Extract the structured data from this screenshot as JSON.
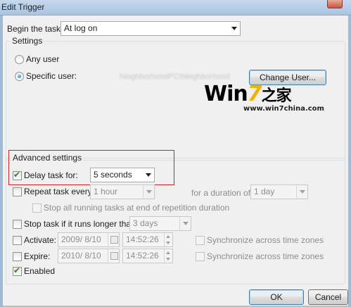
{
  "window": {
    "title": "Edit Trigger"
  },
  "begin": {
    "label": "Begin the task:",
    "value": "At log on"
  },
  "settings": {
    "group_title": "Settings",
    "any_user_label": "Any user",
    "specific_user_label": "Specific user:",
    "user_value": "NeighborhoodPC\\Neighborhood",
    "change_user_label": "Change User...",
    "selected": "specific_user"
  },
  "watermark": {
    "logo_win": "Win",
    "logo_seven": "7",
    "logo_cn": "之家",
    "url": "www.win7china.com"
  },
  "advanced": {
    "group_title": "Advanced settings",
    "delay": {
      "label": "Delay task for:",
      "value": "5 seconds",
      "checked": true
    },
    "repeat": {
      "label": "Repeat task every:",
      "value": "1 hour",
      "checked": false
    },
    "duration": {
      "label": "for a duration of:",
      "value": "1 day"
    },
    "stop_running": {
      "label": "Stop all running tasks at end of repetition duration",
      "checked": false
    },
    "stop_longer": {
      "label": "Stop task if it runs longer than:",
      "value": "3 days",
      "checked": false
    },
    "activate": {
      "label": "Activate:",
      "date": "2009/ 8/10",
      "time": "14:52:26",
      "checked": false
    },
    "expire": {
      "label": "Expire:",
      "date": "2010/ 8/10",
      "time": "14:52:26",
      "checked": false
    },
    "sync1": {
      "label": "Synchronize across time zones",
      "checked": false
    },
    "sync2": {
      "label": "Synchronize across time zones",
      "checked": false
    },
    "enabled": {
      "label": "Enabled",
      "checked": true
    }
  },
  "buttons": {
    "ok": "OK",
    "cancel": "Cancel"
  },
  "colors": {
    "highlight_border": "#c8222a",
    "window_frame": "#9fb9d6",
    "dialog_bg": "#f0f0f0"
  }
}
